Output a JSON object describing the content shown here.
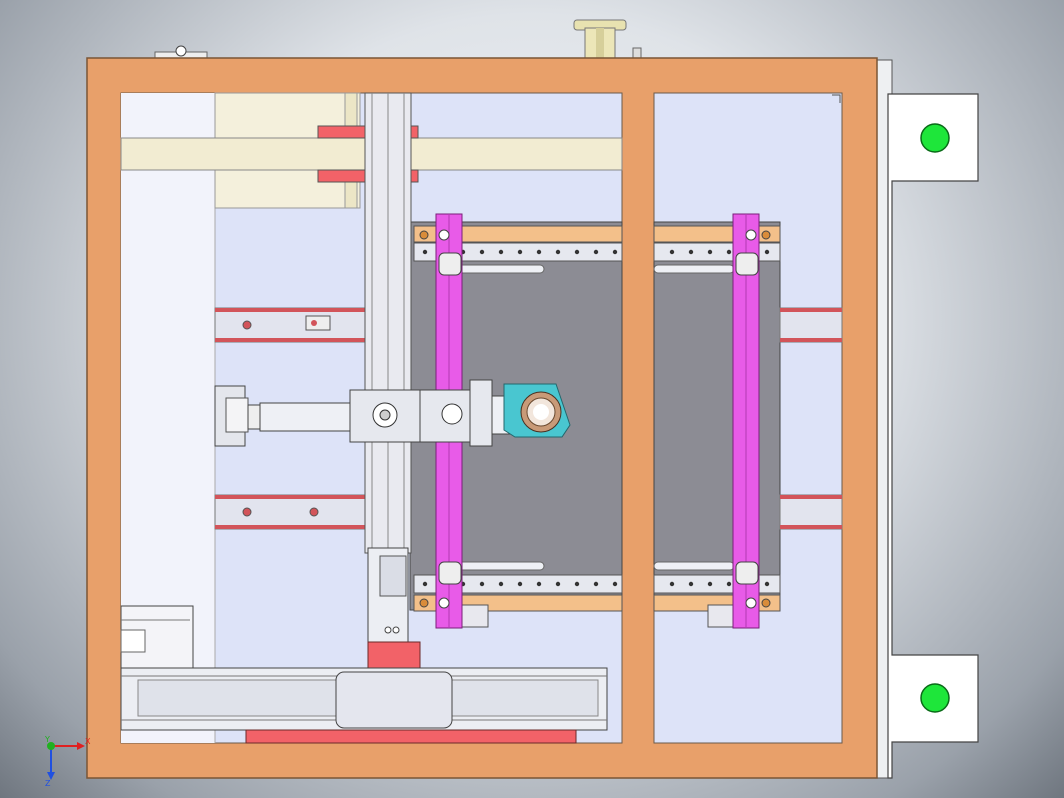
{
  "viewport": {
    "background_center": "#f4f6f8",
    "background_edge": "#6f767f"
  },
  "colors": {
    "frame": "#e8a06a",
    "frame_edge": "#7a5535",
    "panel_bg": "#dde3f8",
    "panel_light": "#f2f3fb",
    "plate": "#8c8c94",
    "magenta": "#e85be8",
    "cyan": "#49c6d0",
    "red_block": "#f26268",
    "red_rail": "#d2545a",
    "beam": "#f2ecd2",
    "green_dot": "#1ee63a",
    "tab_white": "#ffffff",
    "axis_x": "#e02020",
    "axis_y": "#20b020",
    "axis_z": "#2050e0"
  },
  "triad": {
    "y_label": "Y",
    "x_label": "X",
    "z_label": "Z"
  }
}
